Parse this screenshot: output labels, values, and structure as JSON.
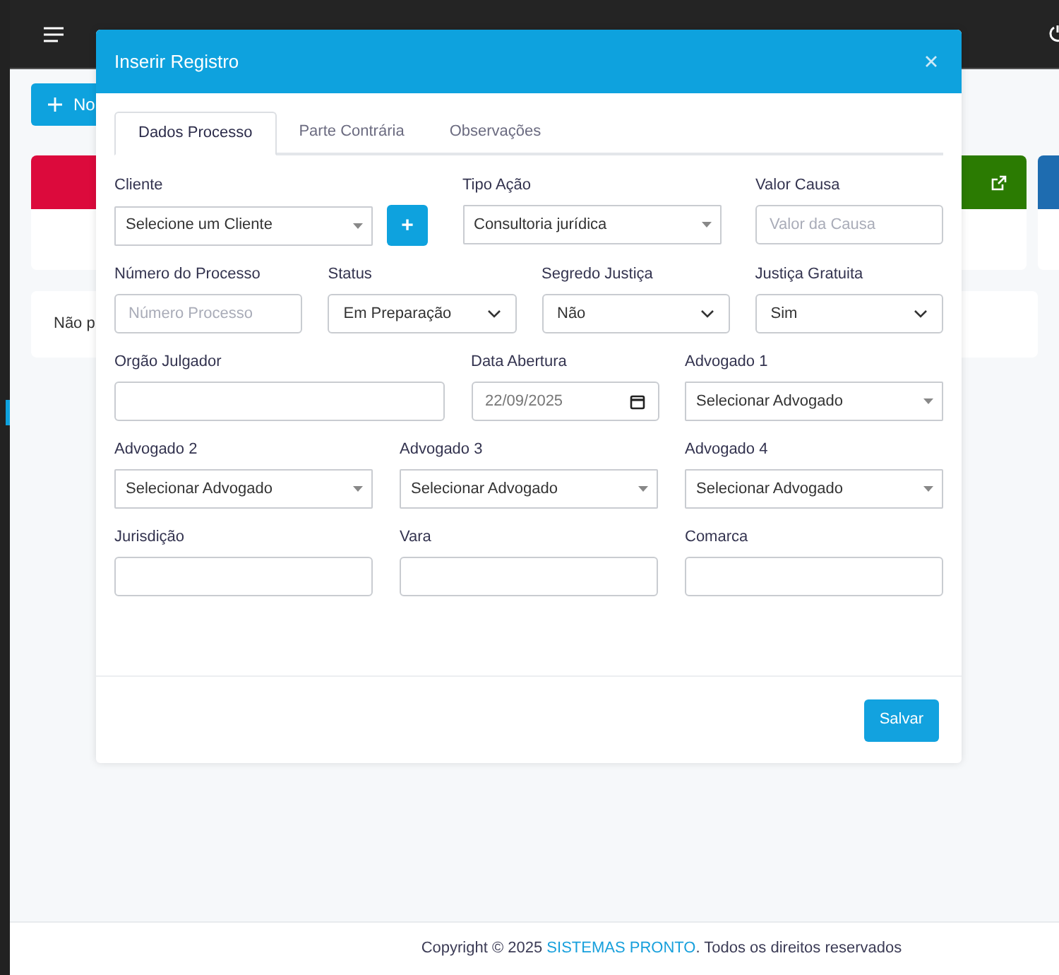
{
  "background": {
    "new_button": "No",
    "notice": "Não p"
  },
  "modal": {
    "title": "Inserir Registro",
    "tabs": [
      {
        "label": "Dados Processo",
        "selected": true
      },
      {
        "label": "Parte Contrária",
        "selected": false
      },
      {
        "label": "Observações",
        "selected": false
      }
    ],
    "rows": [
      {
        "fields": [
          {
            "label": "Cliente",
            "kind": "select2",
            "value": "Selecione um Cliente",
            "add_button": "+"
          },
          {
            "label": "Tipo Ação",
            "kind": "select2",
            "value": "Consultoria jurídica"
          },
          {
            "label": "Valor Causa",
            "kind": "text",
            "placeholder": "Valor da Causa"
          }
        ]
      },
      {
        "fields": [
          {
            "label": "Número do Processo",
            "kind": "text",
            "placeholder": "Número Processo"
          },
          {
            "label": "Status",
            "kind": "select",
            "value": "Em Preparação"
          },
          {
            "label": "Segredo Justiça",
            "kind": "select",
            "value": "Não"
          },
          {
            "label": "Justiça Gratuita",
            "kind": "select",
            "value": "Sim"
          }
        ]
      },
      {
        "fields": [
          {
            "label": "Orgão Julgador",
            "kind": "text"
          },
          {
            "label": "Data Abertura",
            "kind": "date",
            "value": "22/09/2025"
          },
          {
            "label": "Advogado 1",
            "kind": "select2",
            "value": "Selecionar Advogado"
          }
        ]
      },
      {
        "fields": [
          {
            "label": "Advogado 2",
            "kind": "select2",
            "value": "Selecionar Advogado"
          },
          {
            "label": "Advogado 3",
            "kind": "select2",
            "value": "Selecionar Advogado"
          },
          {
            "label": "Advogado 4",
            "kind": "select2",
            "value": "Selecionar Advogado"
          }
        ]
      },
      {
        "fields": [
          {
            "label": "Jurisdição",
            "kind": "text"
          },
          {
            "label": "Vara",
            "kind": "text"
          },
          {
            "label": "Comarca",
            "kind": "text"
          }
        ]
      }
    ],
    "save_button": "Salvar"
  },
  "footer": {
    "prefix": "Copyright © 2025 ",
    "link": "SISTEMAS PRONTO",
    "suffix": ". Todos os direitos reservados"
  }
}
